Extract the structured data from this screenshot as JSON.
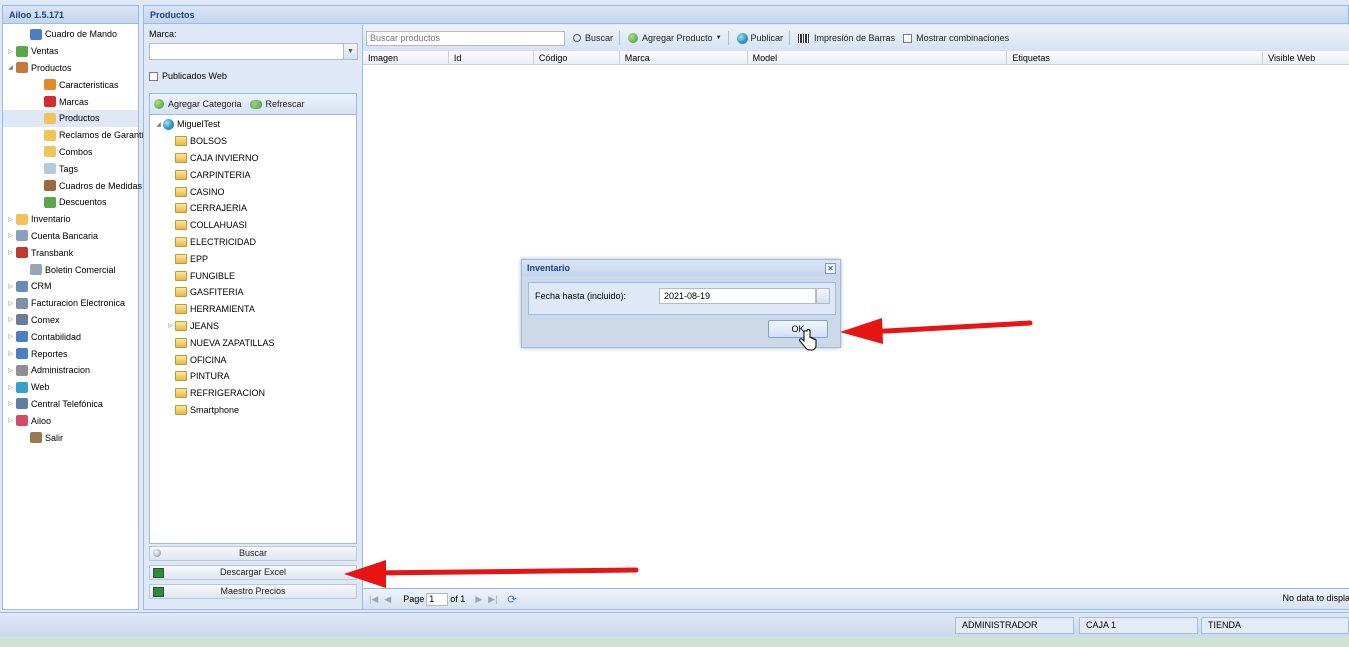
{
  "nav": {
    "title": "Ailoo 1.5.171",
    "items": [
      {
        "label": "Cuadro de Mando",
        "icon": "bar-chart-icon",
        "toggle": "",
        "indent": 1,
        "color": "#4a7fc1"
      },
      {
        "label": "Ventas",
        "icon": "money-icon",
        "toggle": "▷",
        "indent": 0,
        "color": "#5aa64a"
      },
      {
        "label": "Productos",
        "icon": "box-icon",
        "toggle": "◢",
        "indent": 0,
        "color": "#c4773a"
      },
      {
        "label": "Caracteristicas",
        "icon": "grid-icon",
        "toggle": "",
        "indent": 2,
        "color": "#e38a2d"
      },
      {
        "label": "Marcas",
        "icon": "ribbon-icon",
        "toggle": "",
        "indent": 2,
        "color": "#d62b2b"
      },
      {
        "label": "Productos",
        "icon": "package-icon",
        "toggle": "",
        "indent": 2,
        "color": "#f0c35b",
        "selected": true
      },
      {
        "label": "Reclamos de Garantía",
        "icon": "folder-icon",
        "toggle": "",
        "indent": 2,
        "color": "#f0c35b"
      },
      {
        "label": "Combos",
        "icon": "folder-icon",
        "toggle": "",
        "indent": 2,
        "color": "#f0c35b"
      },
      {
        "label": "Tags",
        "icon": "tag-icon",
        "toggle": "",
        "indent": 2,
        "color": "#b6c8de"
      },
      {
        "label": "Cuadros de Medidas",
        "icon": "ruler-icon",
        "toggle": "",
        "indent": 2,
        "color": "#9a6a3a"
      },
      {
        "label": "Descuentos",
        "icon": "discount-icon",
        "toggle": "",
        "indent": 2,
        "color": "#5aa64a"
      },
      {
        "label": "Inventario",
        "icon": "inventory-icon",
        "toggle": "▷",
        "indent": 0,
        "color": "#f0c35b"
      },
      {
        "label": "Cuenta Bancaria",
        "icon": "bank-icon",
        "toggle": "▷",
        "indent": 0,
        "color": "#8aa0b8"
      },
      {
        "label": "Transbank",
        "icon": "transbank-icon",
        "toggle": "▷",
        "indent": 0,
        "color": "#c0392b"
      },
      {
        "label": "Boletin Comercial",
        "icon": "document-icon",
        "toggle": "",
        "indent": 1,
        "color": "#9aa5b3"
      },
      {
        "label": "CRM",
        "icon": "users-icon",
        "toggle": "▷",
        "indent": 0,
        "color": "#6a8bb5"
      },
      {
        "label": "Facturacion Electronica",
        "icon": "invoice-icon",
        "toggle": "▷",
        "indent": 0,
        "color": "#7f8fa5"
      },
      {
        "label": "Comex",
        "icon": "truck-icon",
        "toggle": "▷",
        "indent": 0,
        "color": "#6b7d96"
      },
      {
        "label": "Contabilidad",
        "icon": "book-icon",
        "toggle": "▷",
        "indent": 0,
        "color": "#4a7fc1"
      },
      {
        "label": "Reportes",
        "icon": "report-chart-icon",
        "toggle": "▷",
        "indent": 0,
        "color": "#4a7fc1"
      },
      {
        "label": "Administracion",
        "icon": "gear-icon",
        "toggle": "▷",
        "indent": 0,
        "color": "#8f8f8f"
      },
      {
        "label": "Web",
        "icon": "globe-icon",
        "toggle": "▷",
        "indent": 0,
        "color": "#3a9fc4"
      },
      {
        "label": "Central Telefónica",
        "icon": "phone-icon",
        "toggle": "▷",
        "indent": 0,
        "color": "#5f7ea3"
      },
      {
        "label": "Ailoo",
        "icon": "ailoo-logo-icon",
        "toggle": "▷",
        "indent": 0,
        "color": "#d64a6a"
      },
      {
        "label": "Salir",
        "icon": "exit-icon",
        "toggle": "",
        "indent": 1,
        "color": "#9a7a4a"
      }
    ]
  },
  "main": {
    "title": "Productos",
    "filters": {
      "marca_label": "Marca:",
      "marca_value": "",
      "publicados_label": "Publicados Web",
      "add_category_label": "Agregar Categoria",
      "refresh_label": "Refrescar",
      "root": "MiguelTest",
      "categories": [
        {
          "label": "BOLSOS",
          "expandable": false
        },
        {
          "label": "CAJA INVIERNO",
          "expandable": false
        },
        {
          "label": "CARPINTERIA",
          "expandable": false
        },
        {
          "label": "CASINO",
          "expandable": false
        },
        {
          "label": "CERRAJERIA",
          "expandable": false
        },
        {
          "label": "COLLAHUASI",
          "expandable": false
        },
        {
          "label": "ELECTRICIDAD",
          "expandable": false
        },
        {
          "label": "EPP",
          "expandable": false
        },
        {
          "label": "FUNGIBLE",
          "expandable": false
        },
        {
          "label": "GASFITERIA",
          "expandable": false
        },
        {
          "label": "HERRAMIENTA",
          "expandable": false
        },
        {
          "label": "JEANS",
          "expandable": true
        },
        {
          "label": "NUEVA ZAPATILLAS",
          "expandable": false
        },
        {
          "label": "OFICINA",
          "expandable": false
        },
        {
          "label": "PINTURA",
          "expandable": false
        },
        {
          "label": "REFRIGERACION",
          "expandable": false
        },
        {
          "label": "Smartphone",
          "expandable": false
        }
      ],
      "buscar_label": "Buscar",
      "descargar_label": "Descargar Excel",
      "maestro_label": "Maestro Precios"
    },
    "grid": {
      "search_placeholder": "Buscar productos",
      "buscar_label": "Buscar",
      "agregar_label": "Agregar Producto",
      "publicar_label": "Publicar",
      "impresion_label": "Impresión de Barras",
      "mostrar_label": "Mostrar combinaciones",
      "columns": [
        "Imagen",
        "Id",
        "Código",
        "Marca",
        "Model",
        "Etiquetas",
        "Visible Web"
      ],
      "pager": {
        "page_label": "Page",
        "page_value": "1",
        "of_label": "of 1",
        "nodata": "No data to displa"
      }
    }
  },
  "status": {
    "user": "ADMINISTRADOR",
    "caja": "CAJA 1",
    "tienda": "TIENDA"
  },
  "modal": {
    "title": "Inventario",
    "field_label": "Fecha hasta (incluido):",
    "date_value": "2021-08-19",
    "ok_label": "OK"
  },
  "colors": {
    "arrow": "#e81414",
    "header_text": "#15428b"
  }
}
